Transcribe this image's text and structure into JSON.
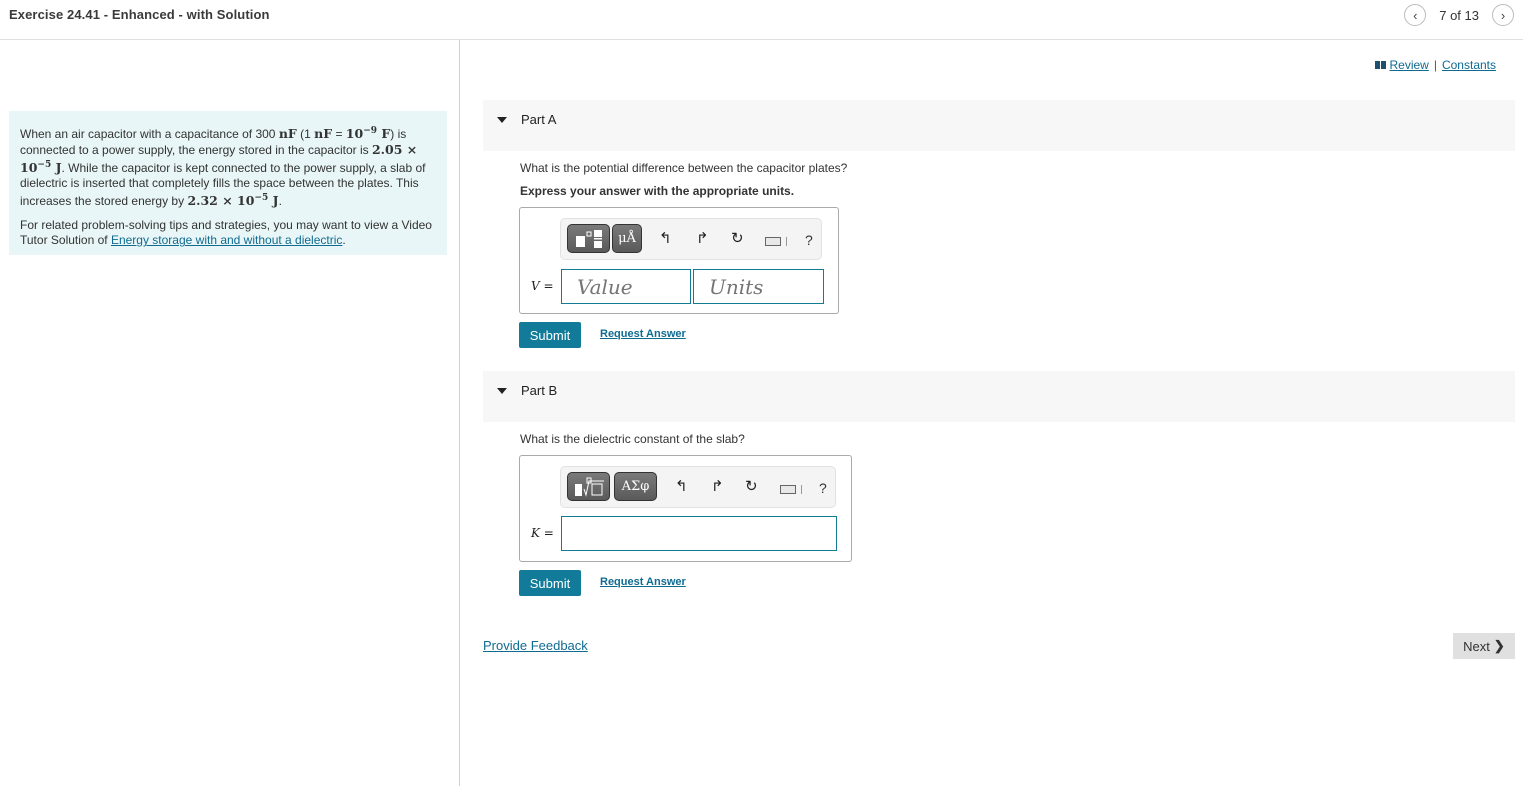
{
  "header": {
    "title": "Exercise 24.41 - Enhanced - with Solution",
    "pager": {
      "prev_icon": "chevron-left-icon",
      "text": "7 of 13",
      "next_icon": "chevron-right-icon"
    }
  },
  "resources": {
    "review_icon": "book-icon",
    "review_label": "Review",
    "separator": "|",
    "constants_label": "Constants"
  },
  "problem": {
    "p1_a": "When an air capacitor with a capacitance of 300 ",
    "p1_nf": "nF",
    "p1_b": " (1 ",
    "p1_nf2": "nF",
    "p1_c": " = ",
    "p1_pow_base": "10",
    "p1_pow_exp": "−9",
    "p1_F": " F",
    "p1_d": ") is connected to a power supply, the energy stored in the capacitor is ",
    "energy1_mant": "2.05 × 10",
    "energy1_exp": "−5",
    "energy1_unit": " J",
    "p1_e": ". While the capacitor is kept connected to the power supply, a slab of dielectric is inserted that completely fills the space between the plates. This increases the stored energy by ",
    "energy2_mant": "2.32 × 10",
    "energy2_exp": "−5",
    "energy2_unit": " J",
    "p1_f": ".",
    "p2_text": "For related problem-solving tips and strategies, you may want to view a Video Tutor Solution of ",
    "p2_link": "Energy storage with and without a dielectric",
    "p2_end": "."
  },
  "parts": [
    {
      "label": "Part A",
      "question": "What is the potential difference between the capacitor plates?",
      "instruction": "Express your answer with the appropriate units.",
      "toolbar": {
        "btn1_icon": "templates-icon",
        "btn2_label": "μÅ",
        "undo_icon": "undo-icon",
        "redo_icon": "redo-icon",
        "reset_icon": "reset-icon",
        "keyboard_icon": "keyboard-icon",
        "help_label": "?"
      },
      "variable": "V",
      "equals": "=",
      "value_placeholder": "Value",
      "units_placeholder": "Units",
      "submit_label": "Submit",
      "request_label": "Request Answer"
    },
    {
      "label": "Part B",
      "question": "What is the dielectric constant of the slab?",
      "toolbar": {
        "btn1_icon": "templates-icon",
        "btn2_label": "ΑΣφ",
        "undo_icon": "undo-icon",
        "redo_icon": "redo-icon",
        "reset_icon": "reset-icon",
        "keyboard_icon": "keyboard-icon",
        "help_label": "?"
      },
      "variable": "K",
      "equals": "=",
      "value": "",
      "submit_label": "Submit",
      "request_label": "Request Answer"
    }
  ],
  "footer": {
    "feedback_label": "Provide Feedback",
    "next_label": "Next",
    "next_icon": "chevron-right-icon"
  }
}
